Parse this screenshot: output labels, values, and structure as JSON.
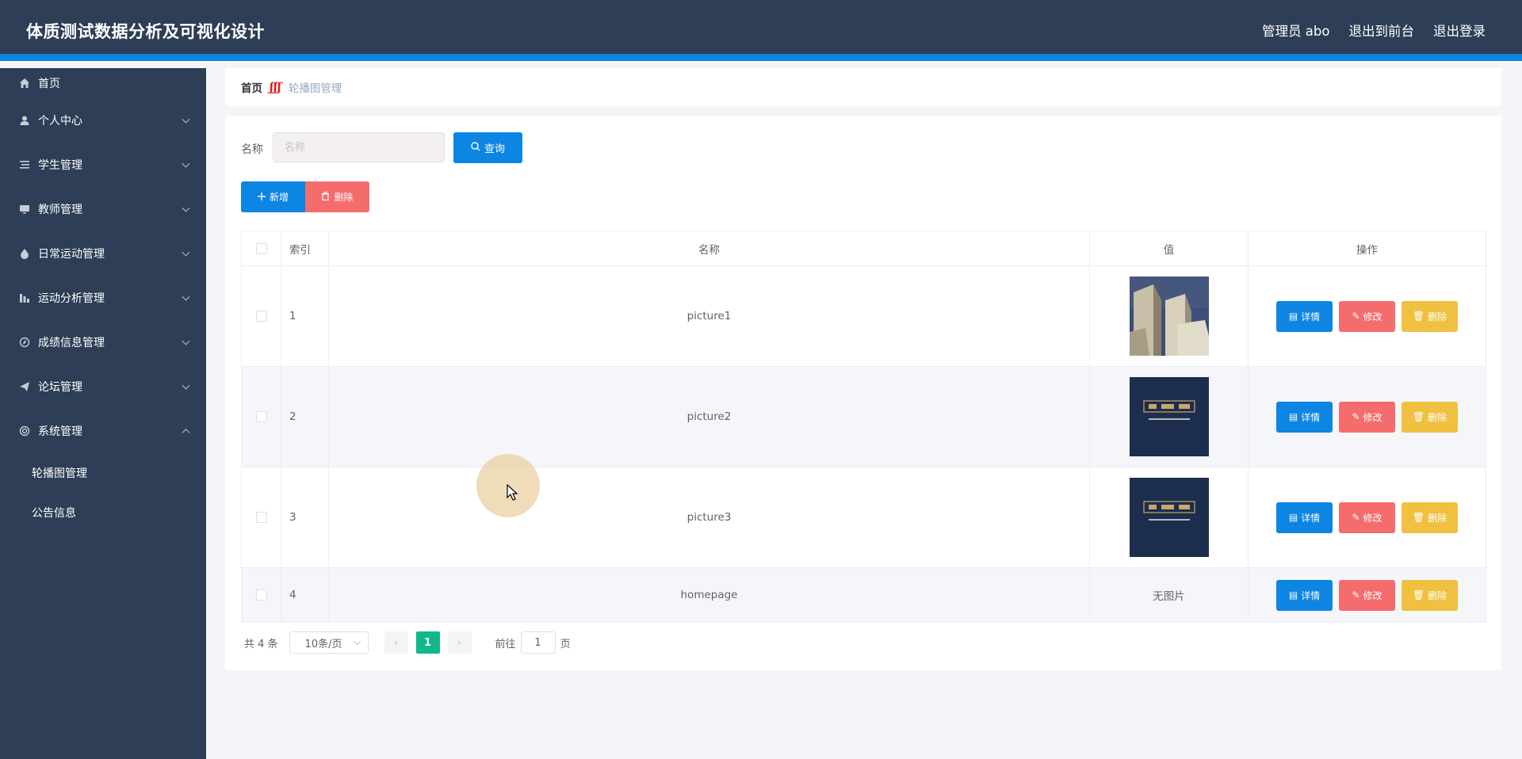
{
  "header": {
    "app_title": "体质测试数据分析及可视化设计",
    "user_label": "管理员 abo",
    "to_front_label": "退出到前台",
    "logout_label": "退出登录"
  },
  "sidebar": {
    "items": [
      {
        "label": "首页",
        "icon": "home-icon"
      },
      {
        "label": "个人中心",
        "icon": "user-icon"
      },
      {
        "label": "学生管理",
        "icon": "list-icon"
      },
      {
        "label": "教师管理",
        "icon": "monitor-icon"
      },
      {
        "label": "日常运动管理",
        "icon": "drop-icon"
      },
      {
        "label": "运动分析管理",
        "icon": "chart-icon"
      },
      {
        "label": "成绩信息管理",
        "icon": "compass-icon"
      },
      {
        "label": "论坛管理",
        "icon": "send-icon"
      },
      {
        "label": "系统管理",
        "icon": "circle-icon"
      }
    ],
    "sub_items": [
      "轮播图管理",
      "公告信息"
    ]
  },
  "breadcrumb": {
    "home": "首页",
    "current": "轮播图管理"
  },
  "search": {
    "label": "名称",
    "placeholder": "名称",
    "query_label": "查询"
  },
  "actions": {
    "add_label": "新增",
    "delete_label": "删除"
  },
  "table": {
    "headers": [
      "索引",
      "名称",
      "值",
      "操作"
    ],
    "rows": [
      {
        "index": "1",
        "name": "picture1",
        "value_image": "building-photo"
      },
      {
        "index": "2",
        "name": "picture2",
        "value_image": "dark-banner"
      },
      {
        "index": "3",
        "name": "picture3",
        "value_image": "dark-banner"
      },
      {
        "index": "4",
        "name": "homepage",
        "value_text": "无图片"
      }
    ],
    "op_labels": {
      "detail": "详情",
      "edit": "修改",
      "delete": "删除"
    }
  },
  "pagination": {
    "total": "共 4 条",
    "page_size": "10条/页",
    "current_page": "1",
    "goto_label": "前往",
    "goto_value": "1",
    "page_unit": "页"
  },
  "colors": {
    "sidebar_bg": "#2d3e56",
    "accent_blue": "#0d85e2",
    "danger": "#f56c6c",
    "warning": "#f0c040",
    "page_active": "#10b88a"
  }
}
